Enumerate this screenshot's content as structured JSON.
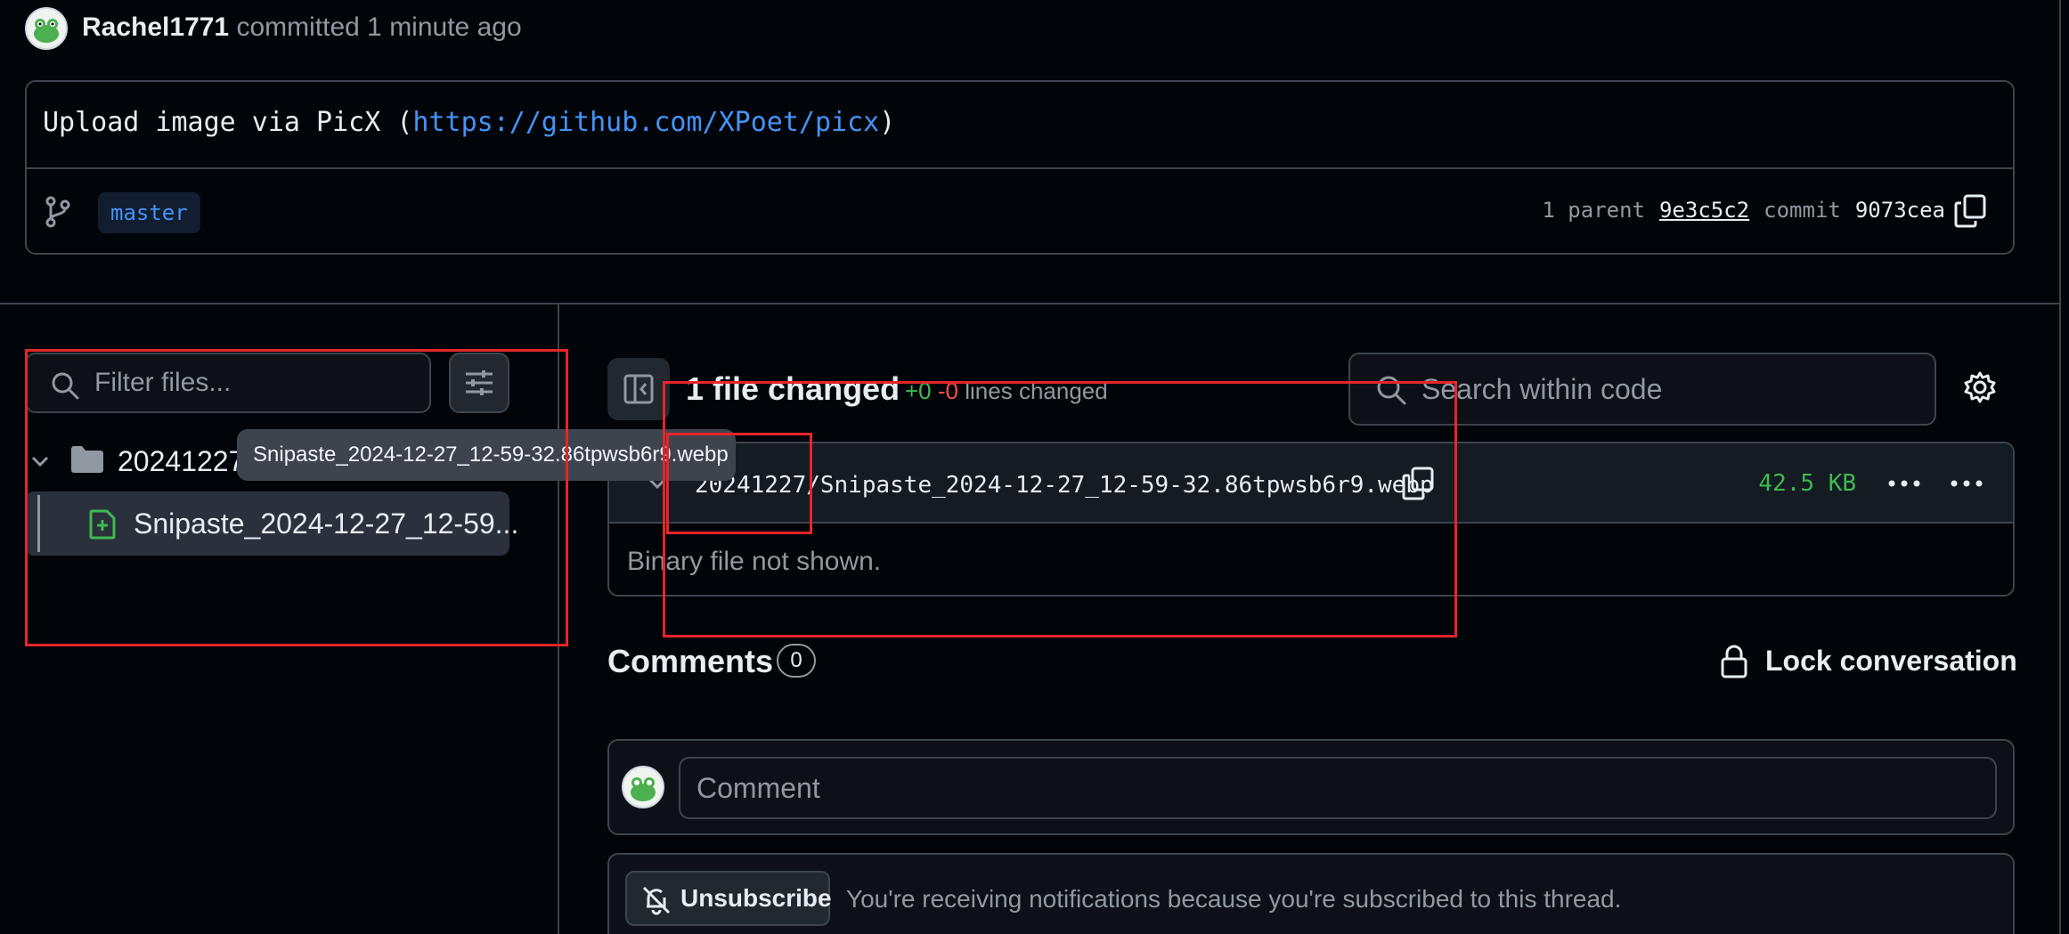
{
  "header": {
    "author": "Rachel1771",
    "action": "committed 1 minute ago"
  },
  "commit": {
    "message_prefix": "Upload image via PicX (",
    "message_link": "https://github.com/XPoet/picx",
    "message_suffix": ")",
    "branch": "master",
    "parent_label": "1 parent",
    "parent_sha": "9e3c5c2",
    "commit_label": "commit",
    "commit_sha": "9073cea"
  },
  "sidebar": {
    "filter_placeholder": "Filter files...",
    "folder_name": "20241227",
    "file_name": "Snipaste_2024-12-27_12-59...",
    "tooltip": "Snipaste_2024-12-27_12-59-32.86tpwsb6r9.webp"
  },
  "diff": {
    "files_changed": "1 file changed",
    "additions": "+0",
    "deletions": "-0",
    "lines_changed": "lines changed",
    "search_placeholder": "Search within code",
    "file_path": "20241227/Snipaste_2024-12-27_12-59-32.86tpwsb6r9.webp",
    "file_size": "42.5 KB",
    "binary_note": "Binary file not shown."
  },
  "comments": {
    "title": "Comments",
    "count": "0",
    "lock_label": "Lock conversation",
    "comment_placeholder": "Comment"
  },
  "subscription": {
    "button_label": "Unsubscribe",
    "notice": "You're receiving notifications because you're subscribed to this thread."
  },
  "colors": {
    "background": "#010409",
    "border": "#3d444d",
    "link": "#4493f8",
    "addition": "#3fb950",
    "deletion": "#f85149",
    "annotation": "#e5252a"
  }
}
